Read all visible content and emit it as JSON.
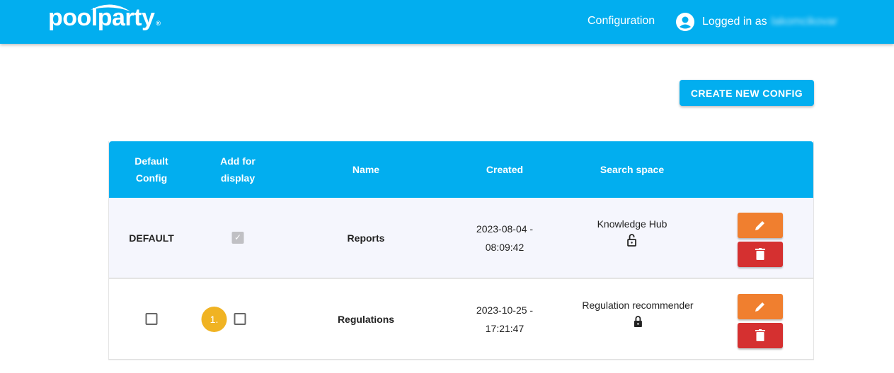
{
  "header": {
    "logo": "poolparty",
    "logo_mark": "®",
    "nav_config": "Configuration",
    "user_prefix": "Logged in as",
    "username": "lakomcikovar"
  },
  "actions": {
    "create": "CREATE NEW CONFIG"
  },
  "table": {
    "columns": [
      "Default Config",
      "Add for display",
      "Name",
      "Created",
      "Search space"
    ],
    "rows": [
      {
        "default": "DEFAULT",
        "display_checked": true,
        "order": "",
        "name": "Reports",
        "created_date": "2023-08-04 -",
        "created_time": "08:09:42",
        "space": "Knowledge Hub",
        "lock": "unlocked"
      },
      {
        "default": "",
        "default_checked": false,
        "display_checked": false,
        "order": "1.",
        "name": "Regulations",
        "created_date": "2023-10-25 -",
        "created_time": "17:21:47",
        "space": "Regulation recommender",
        "lock": "locked"
      }
    ]
  },
  "colors": {
    "primary": "#02aeef",
    "edit": "#f07f2f",
    "delete": "#d53030",
    "badge": "#f0b323"
  }
}
